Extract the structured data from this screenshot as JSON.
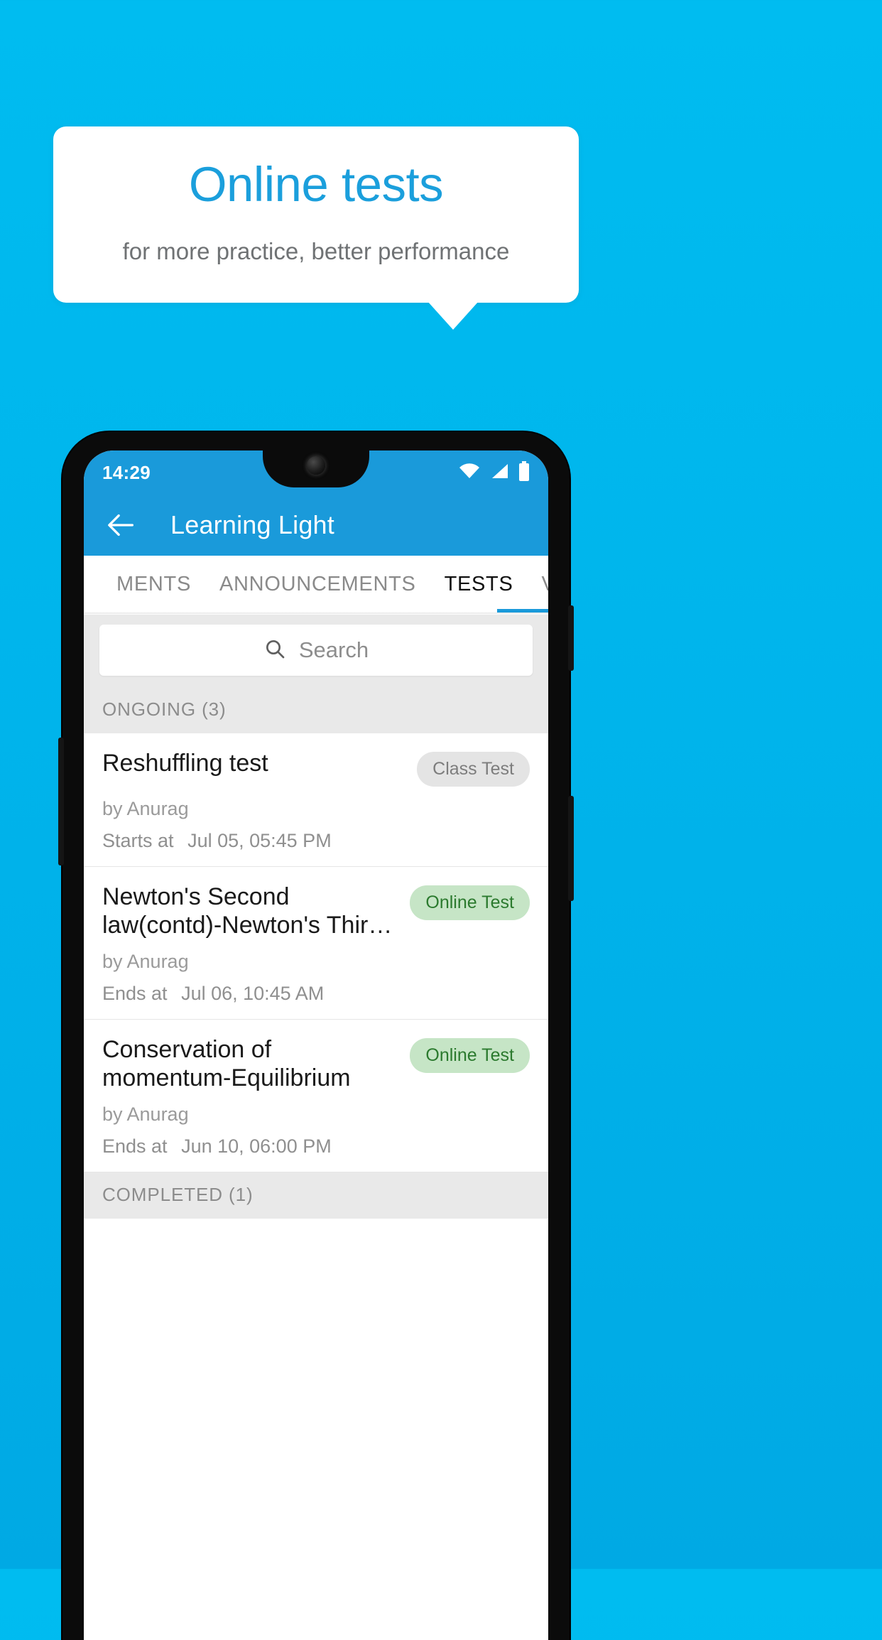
{
  "promo": {
    "title": "Online tests",
    "subtitle": "for more practice, better performance"
  },
  "colors": {
    "background": "#00b5ec",
    "accent": "#1a9ada",
    "title_blue": "#1b9fdc",
    "badge_green_bg": "#c6e5c6",
    "badge_green_text": "#2b7a2e",
    "badge_grey_bg": "#e4e4e4",
    "badge_grey_text": "#7d7d7d"
  },
  "phone": {
    "status_bar": {
      "time": "14:29",
      "icons": [
        "wifi-icon",
        "signal-icon",
        "battery-icon"
      ]
    },
    "appbar": {
      "back_icon": "back-arrow-icon",
      "title": "Learning Light"
    },
    "tabs": [
      {
        "label": "MENTS",
        "active": false
      },
      {
        "label": "ANNOUNCEMENTS",
        "active": false
      },
      {
        "label": "TESTS",
        "active": true
      },
      {
        "label": "VIDEOS",
        "active": false
      }
    ],
    "search": {
      "icon": "search-icon",
      "placeholder": "Search",
      "value": ""
    },
    "sections": [
      {
        "header": "ONGOING (3)",
        "tests": [
          {
            "title": "Reshuffling test",
            "badge": "Class Test",
            "badge_type": "grey",
            "author": "by Anurag",
            "time_label": "Starts at",
            "time_value": "Jul 05, 05:45 PM"
          },
          {
            "title": "Newton's Second law(contd)-Newton's Thir…",
            "badge": "Online Test",
            "badge_type": "green",
            "author": "by Anurag",
            "time_label": "Ends at",
            "time_value": "Jul 06, 10:45 AM"
          },
          {
            "title": "Conservation of momentum-Equilibrium",
            "badge": "Online Test",
            "badge_type": "green",
            "author": "by Anurag",
            "time_label": "Ends at",
            "time_value": "Jun 10, 06:00 PM"
          }
        ]
      },
      {
        "header": "COMPLETED (1)",
        "tests": []
      }
    ]
  }
}
